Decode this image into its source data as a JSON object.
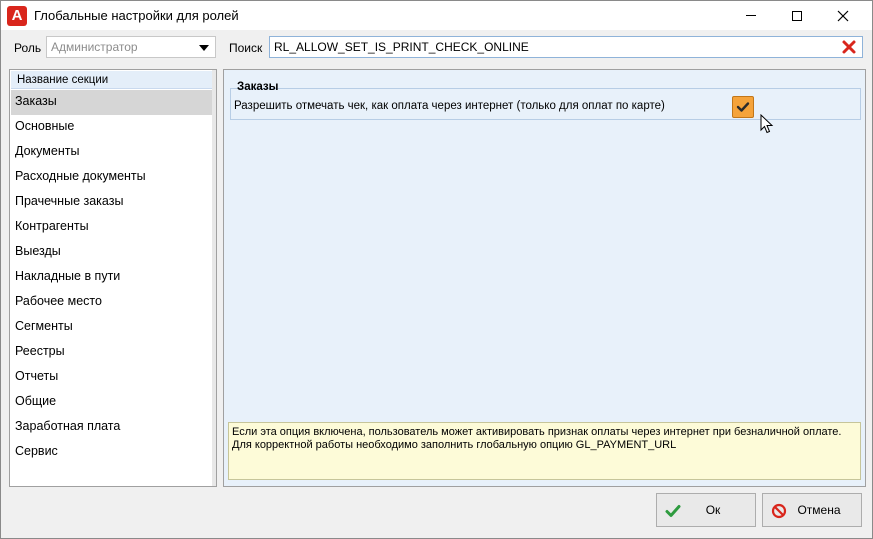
{
  "window": {
    "title": "Глобальные настройки для ролей",
    "app_icon_letter": "A",
    "controls": {
      "minimize": "minimize-icon",
      "maximize": "maximize-icon",
      "close": "close-icon"
    }
  },
  "role": {
    "label": "Роль",
    "value": "Администратор"
  },
  "search": {
    "label": "Поиск",
    "value": "RL_ALLOW_SET_IS_PRINT_CHECK_ONLINE"
  },
  "sections": {
    "header": "Название секции",
    "items": [
      {
        "label": "Заказы",
        "selected": true
      },
      {
        "label": "Основные"
      },
      {
        "label": "Документы"
      },
      {
        "label": "Расходные документы"
      },
      {
        "label": "Прачечные заказы"
      },
      {
        "label": "Контрагенты"
      },
      {
        "label": "Выезды"
      },
      {
        "label": "Накладные в пути"
      },
      {
        "label": "Рабочее место"
      },
      {
        "label": "Сегменты"
      },
      {
        "label": "Реестры"
      },
      {
        "label": "Отчеты"
      },
      {
        "label": "Общие"
      },
      {
        "label": "Заработная плата"
      },
      {
        "label": "Сервис"
      }
    ]
  },
  "group": {
    "title": "Заказы",
    "option": {
      "label": "Разрешить отмечать чек, как оплата через интернет (только для оплат по карте)",
      "checked": true
    }
  },
  "hint": {
    "line1": "Если эта опция включена, пользователь может активировать признак оплаты через интернет при безналичной оплате.",
    "line2": "Для корректной работы необходимо заполнить глобальную опцию GL_PAYMENT_URL"
  },
  "buttons": {
    "ok": "Ок",
    "cancel": "Отмена"
  },
  "colors": {
    "accent_check": "#f5a33a",
    "panel_bg": "#e8f1fa",
    "hint_bg": "#fdfbd8",
    "clear_red": "#d9261c",
    "ok_green": "#2e9b3f"
  }
}
